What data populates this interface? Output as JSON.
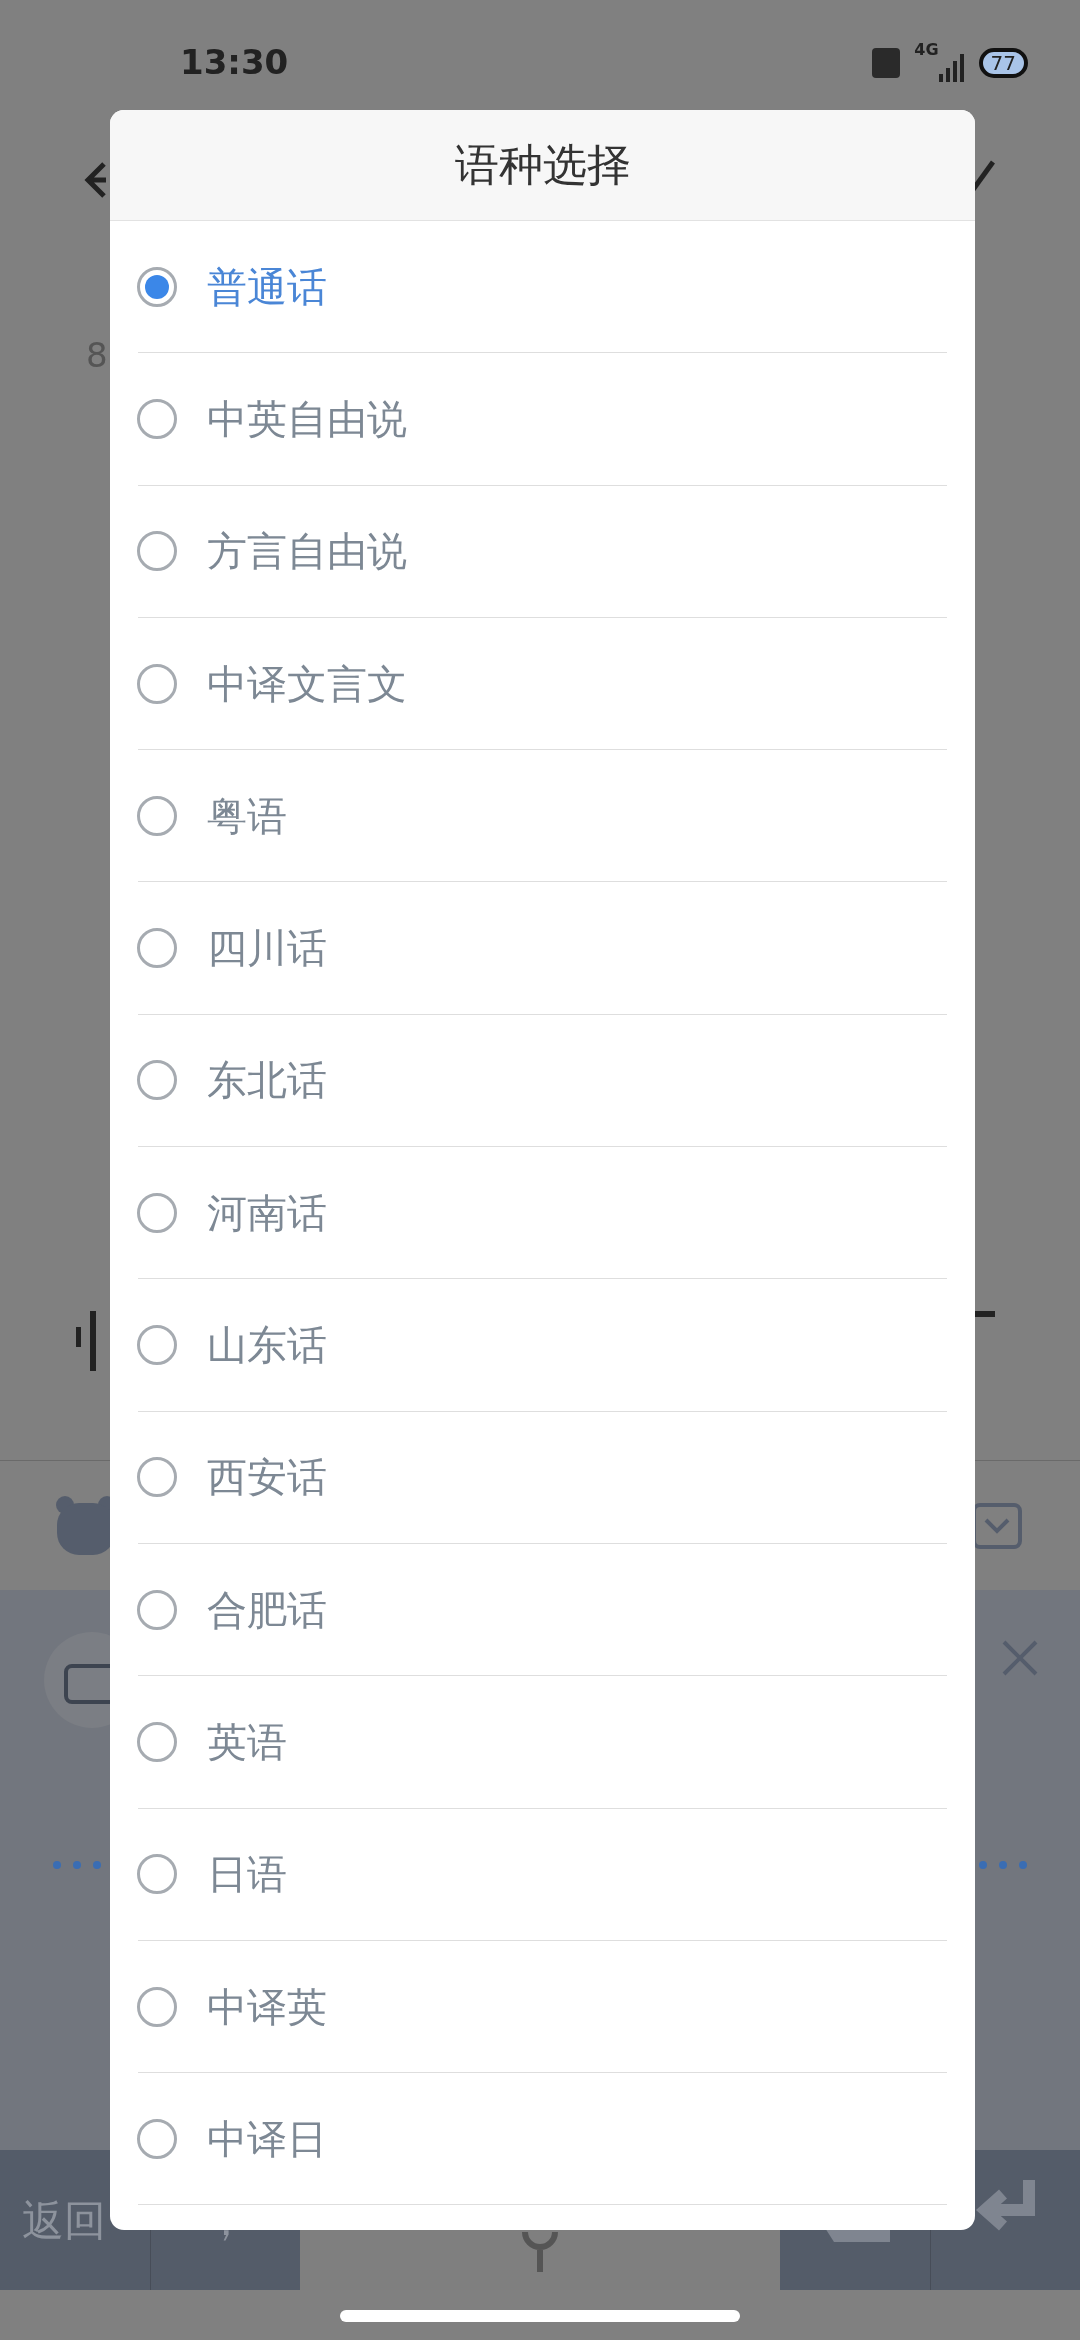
{
  "status_bar": {
    "time": "13:30",
    "network": "4G",
    "battery": "77"
  },
  "background": {
    "line_fragment": "8",
    "keys": [
      {
        "label": "返回",
        "kind": "dark"
      },
      {
        "label": "，",
        "kind": "dark"
      },
      {
        "kind": "mic"
      },
      {
        "kind": "backspace"
      },
      {
        "kind": "enter"
      }
    ]
  },
  "dialog": {
    "title": "语种选择",
    "options": [
      {
        "label": "普通话",
        "selected": true
      },
      {
        "label": "中英自由说",
        "selected": false
      },
      {
        "label": "方言自由说",
        "selected": false
      },
      {
        "label": "中译文言文",
        "selected": false
      },
      {
        "label": "粤语",
        "selected": false
      },
      {
        "label": "四川话",
        "selected": false
      },
      {
        "label": "东北话",
        "selected": false
      },
      {
        "label": "河南话",
        "selected": false
      },
      {
        "label": "山东话",
        "selected": false
      },
      {
        "label": "西安话",
        "selected": false
      },
      {
        "label": "合肥话",
        "selected": false
      },
      {
        "label": "英语",
        "selected": false
      },
      {
        "label": "日语",
        "selected": false
      },
      {
        "label": "中译英",
        "selected": false
      },
      {
        "label": "中译日",
        "selected": false
      }
    ]
  }
}
